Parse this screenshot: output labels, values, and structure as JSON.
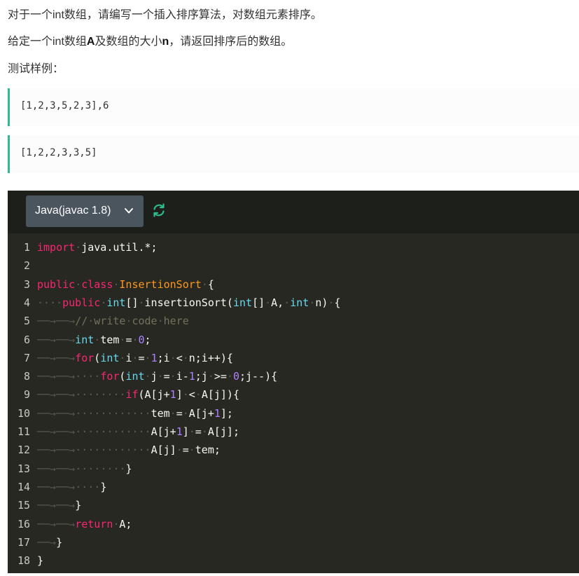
{
  "problem": {
    "line1": "对于一个int数组，请编写一个插入排序算法，对数组元素排序。",
    "line2": {
      "a": "给定一个int数组",
      "b": "A",
      "c": "及数组的大小",
      "d": "n",
      "e": "，请返回排序后的数组。"
    },
    "line3": "测试样例："
  },
  "samples": {
    "input": "[1,2,3,5,2,3],6",
    "output": "[1,2,2,3,3,5]"
  },
  "editor": {
    "language": "Java(javac 1.8)",
    "icons": {
      "dropdown": "chevron-down-icon",
      "refresh": "refresh-icon"
    },
    "colors": {
      "background": "#272822",
      "toolbar": "#1d1f1b",
      "select": "#4b555e",
      "accent": "#2fbb8e",
      "keyword": "#f92672",
      "type": "#66d9ef",
      "class": "#fd971f",
      "number": "#ae81ff",
      "comment": "#75715e"
    },
    "lines": [
      "import java.util.*;",
      "",
      "public class InsertionSort {",
      "    public int[] insertionSort(int[] A, int n) {",
      "\t\t// write code here",
      "\t\tint tem = 0;",
      "\t\tfor(int i = 1;i < n;i++){",
      "\t\t    for(int j = i-1;j >= 0;j--){",
      "\t\t        if(A[j+1] < A[j]){",
      "\t\t            tem = A[j+1];",
      "\t\t            A[j+1] = A[j];",
      "\t\t            A[j] = tem;",
      "\t\t        }",
      "\t\t    }",
      "\t\t}",
      "\t\treturn A;",
      "\t}",
      "}"
    ]
  }
}
